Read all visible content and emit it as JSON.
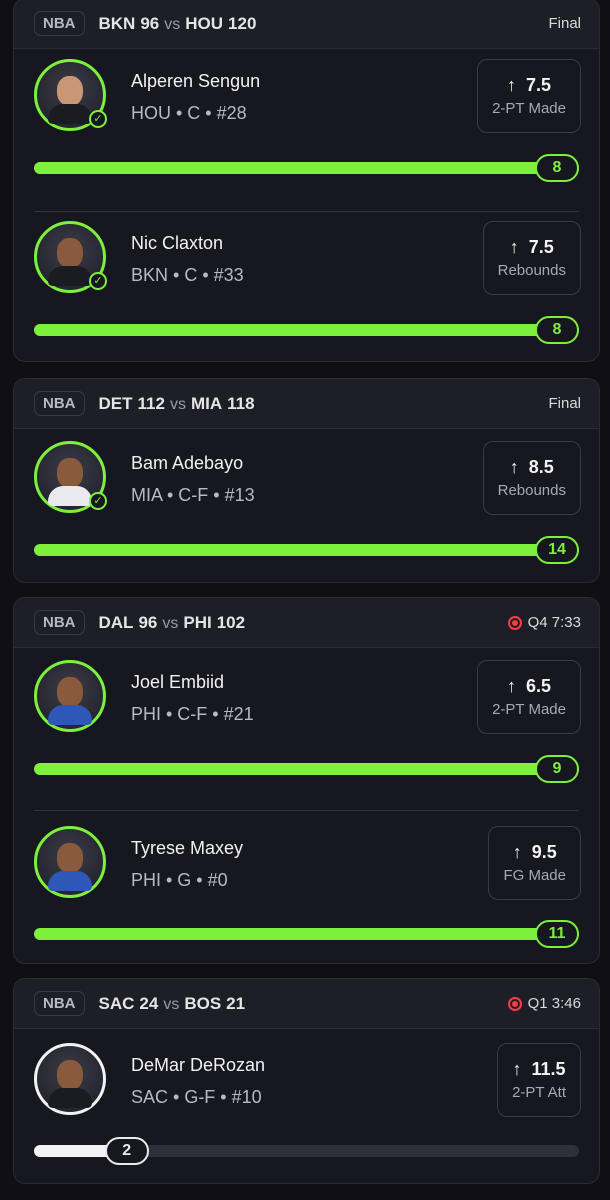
{
  "cards": [
    {
      "league": "NBA",
      "away_team": "BKN",
      "away_score": "96",
      "vs": "vs",
      "home_team": "HOU",
      "home_score": "120",
      "status": "Final",
      "players": [
        {
          "name": "Alperen Sengun",
          "meta": "HOU • C • #28",
          "line": "7.5",
          "stat": "2-PT Made",
          "actual": "8",
          "progress": 1.0
        },
        {
          "name": "Nic Claxton",
          "meta": "BKN • C • #33",
          "line": "7.5",
          "stat": "Rebounds",
          "actual": "8",
          "progress": 1.0
        }
      ]
    },
    {
      "league": "NBA",
      "away_team": "DET",
      "away_score": "112",
      "vs": "vs",
      "home_team": "MIA",
      "home_score": "118",
      "status": "Final",
      "players": [
        {
          "name": "Bam Adebayo",
          "meta": "MIA • C-F • #13",
          "line": "8.5",
          "stat": "Rebounds",
          "actual": "14",
          "progress": 1.0
        }
      ]
    },
    {
      "league": "NBA",
      "away_team": "DAL",
      "away_score": "96",
      "vs": "vs",
      "home_team": "PHI",
      "home_score": "102",
      "status": "Q4 7:33",
      "players": [
        {
          "name": "Joel Embiid",
          "meta": "PHI • C-F • #21",
          "line": "6.5",
          "stat": "2-PT Made",
          "actual": "9",
          "progress": 1.0
        },
        {
          "name": "Tyrese Maxey",
          "meta": "PHI • G • #0",
          "line": "9.5",
          "stat": "FG Made",
          "actual": "11",
          "progress": 1.0
        }
      ]
    },
    {
      "league": "NBA",
      "away_team": "SAC",
      "away_score": "24",
      "vs": "vs",
      "home_team": "BOS",
      "home_score": "21",
      "status": "Q1 3:46",
      "players": [
        {
          "name": "DeMar DeRozan",
          "meta": "SAC • G-F • #10",
          "line": "11.5",
          "stat": "2-PT Att",
          "actual": "2",
          "progress": 0.17
        }
      ]
    }
  ],
  "icons": {
    "arrow": "arrow-up-icon",
    "check": "check-badge-icon",
    "live": "live-indicator-icon"
  },
  "colors": {
    "accent": "#7cf03a",
    "live": "#ff3b47",
    "background": "#0f0f15",
    "card": "#17171f"
  }
}
